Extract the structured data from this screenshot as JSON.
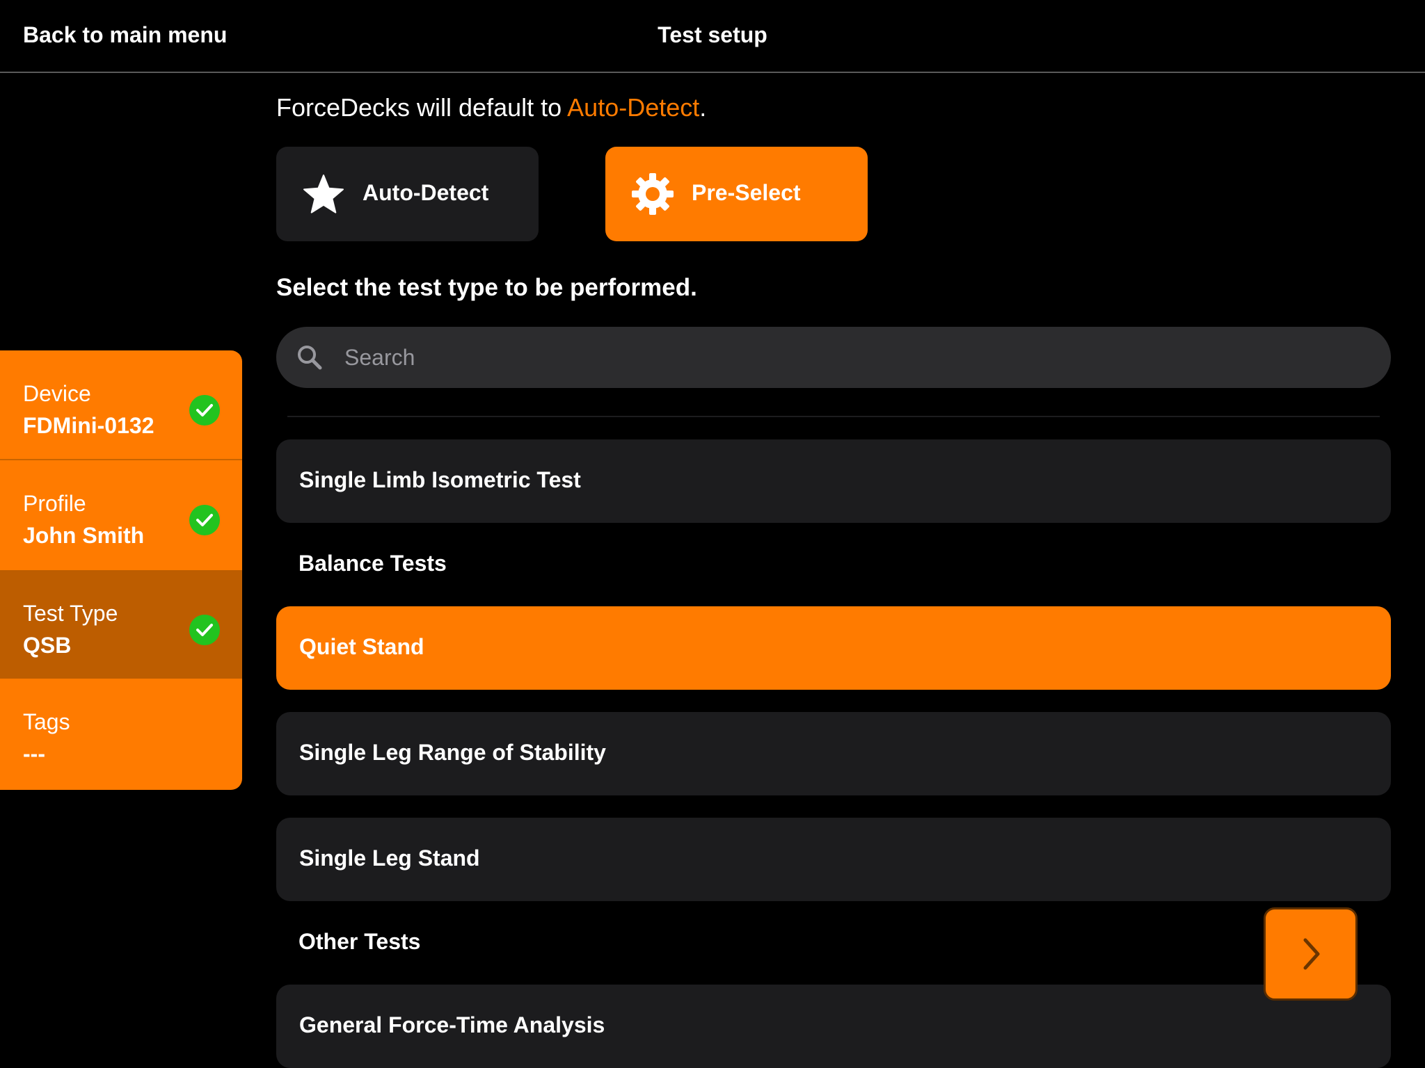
{
  "header": {
    "back_label": "Back to main menu",
    "title": "Test setup"
  },
  "colors": {
    "accent": "#ff7b00",
    "accent_dark": "#bd5d00",
    "card": "#1c1c1e",
    "success": "#22c31f"
  },
  "steps": [
    {
      "label": "Device",
      "value": "FDMini-0132",
      "completed": true,
      "active": false
    },
    {
      "label": "Profile",
      "value": "John Smith",
      "completed": true,
      "active": false
    },
    {
      "label": "Test Type",
      "value": "QSB",
      "completed": true,
      "active": true
    },
    {
      "label": "Tags",
      "value": "---",
      "completed": false,
      "active": false
    }
  ],
  "default_notice": {
    "prefix": "ForceDecks will default to ",
    "highlight": "Auto-Detect",
    "suffix": "."
  },
  "modes": [
    {
      "label": "Auto-Detect",
      "icon": "star-icon",
      "selected": false
    },
    {
      "label": "Pre-Select",
      "icon": "gear-icon",
      "selected": true
    }
  ],
  "instruction": "Select the test type to be performed.",
  "search": {
    "placeholder": "Search",
    "value": ""
  },
  "test_list": {
    "item_1": "Single Limb Isometric Test",
    "group_balance": "Balance Tests",
    "item_2": "Quiet Stand",
    "item_3": "Single Leg Range of Stability",
    "item_4": "Single Leg Stand",
    "group_other": "Other Tests",
    "item_5": "General Force-Time Analysis",
    "selected": "Quiet Stand"
  },
  "next_button": {
    "icon": "chevron-right-icon"
  }
}
